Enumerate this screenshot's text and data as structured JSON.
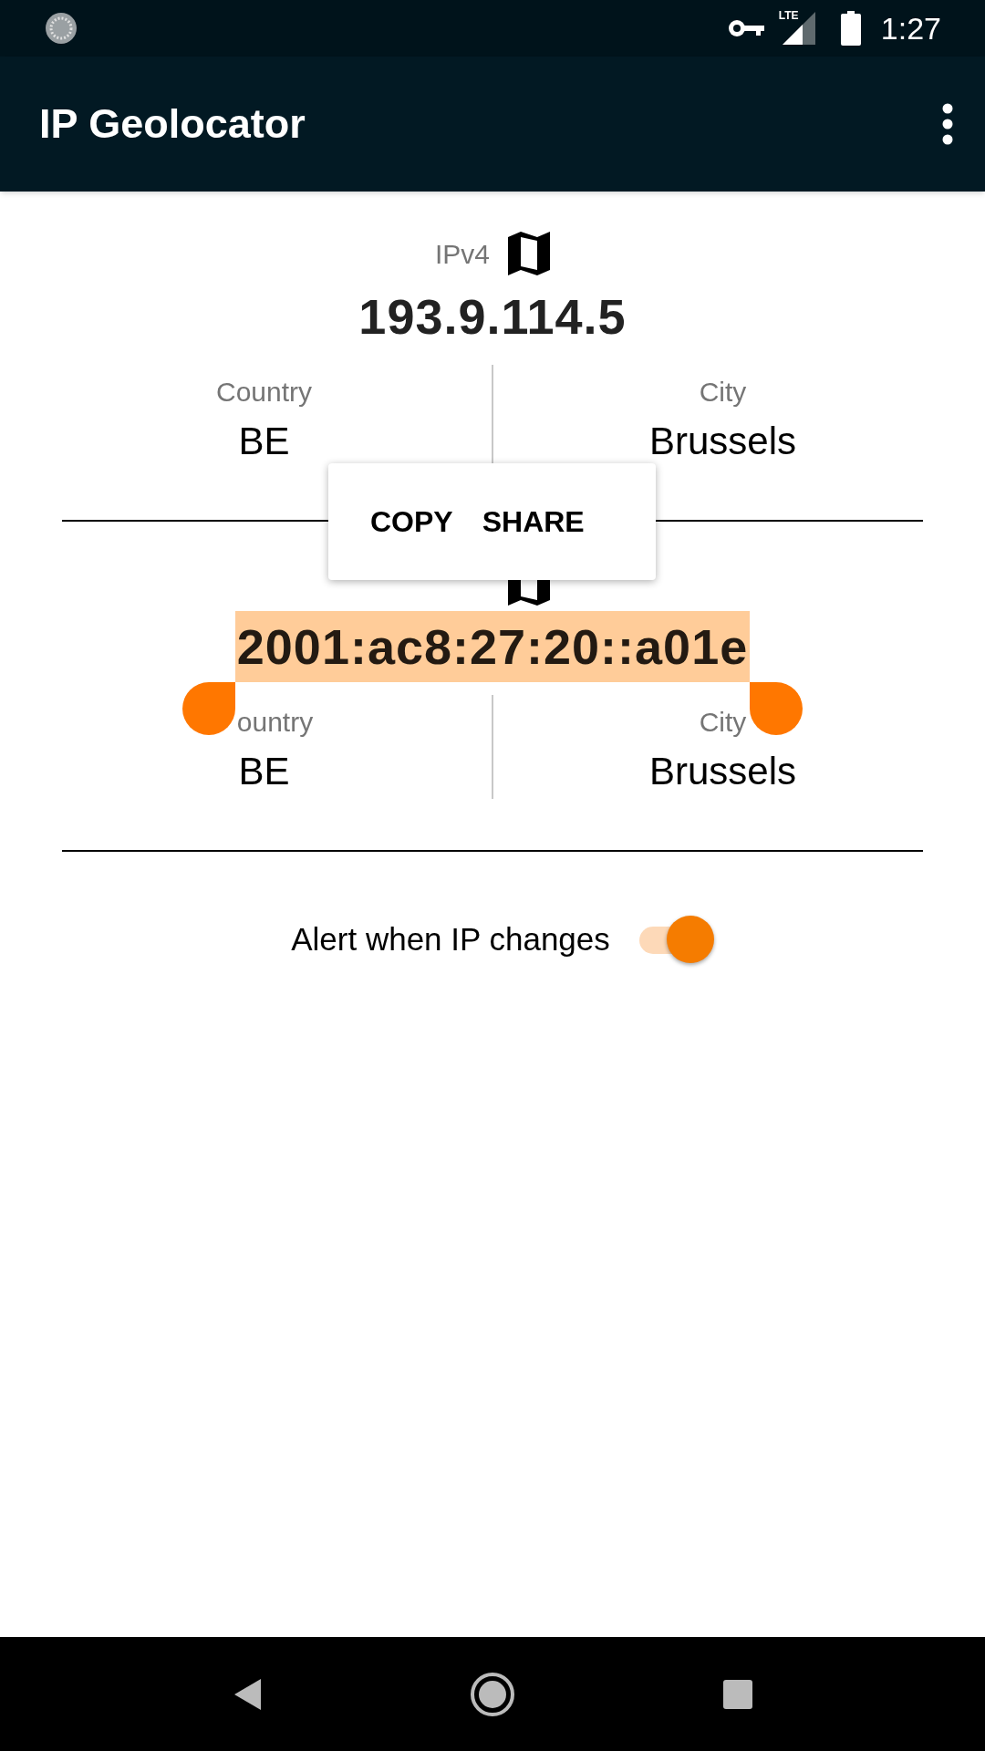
{
  "status_bar": {
    "network": "LTE",
    "time": "1:27"
  },
  "app_bar": {
    "title": "IP Geolocator"
  },
  "sections": [
    {
      "label": "IPv4",
      "address": "193.9.114.5",
      "selected": false,
      "country_label": "Country",
      "country": "BE",
      "city_label": "City",
      "city": "Brussels"
    },
    {
      "address": "2001:ac8:27:20::a01e",
      "selected": true,
      "country_label": "ountry",
      "country": "BE",
      "city_label": "City",
      "city": "Brussels"
    }
  ],
  "selection_menu": {
    "actions": [
      "COPY",
      "SHARE"
    ]
  },
  "alert": {
    "label": "Alert when IP changes",
    "on": true
  }
}
